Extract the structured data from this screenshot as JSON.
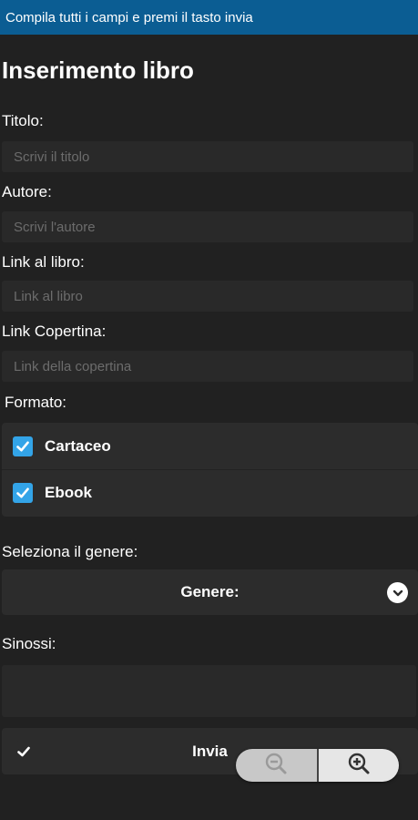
{
  "topbar": {
    "text": "Compila tutti i campi e premi il tasto invia"
  },
  "form": {
    "title": "Inserimento libro",
    "titolo": {
      "label": "Titolo:",
      "placeholder": "Scrivi il titolo",
      "value": ""
    },
    "autore": {
      "label": "Autore:",
      "placeholder": "Scrivi l'autore",
      "value": ""
    },
    "link_libro": {
      "label": "Link al libro:",
      "placeholder": "Link al libro",
      "value": ""
    },
    "link_copertina": {
      "label": "Link Copertina:",
      "placeholder": "Link della copertina",
      "value": ""
    },
    "formato": {
      "label": "Formato:",
      "options": [
        {
          "label": "Cartaceo",
          "checked": true
        },
        {
          "label": "Ebook",
          "checked": true
        }
      ]
    },
    "genere": {
      "label": "Seleziona il genere:",
      "selected": "Genere:"
    },
    "sinossi": {
      "label": "Sinossi:",
      "value": ""
    },
    "submit_label": "Invia"
  },
  "zoom_controls": {
    "zoom_out_icon": "magnify-minus-icon",
    "zoom_in_icon": "magnify-plus-icon"
  },
  "colors": {
    "topbar": "#0b5d93",
    "background": "#212121",
    "accent_checkbox": "#33a4e8"
  }
}
